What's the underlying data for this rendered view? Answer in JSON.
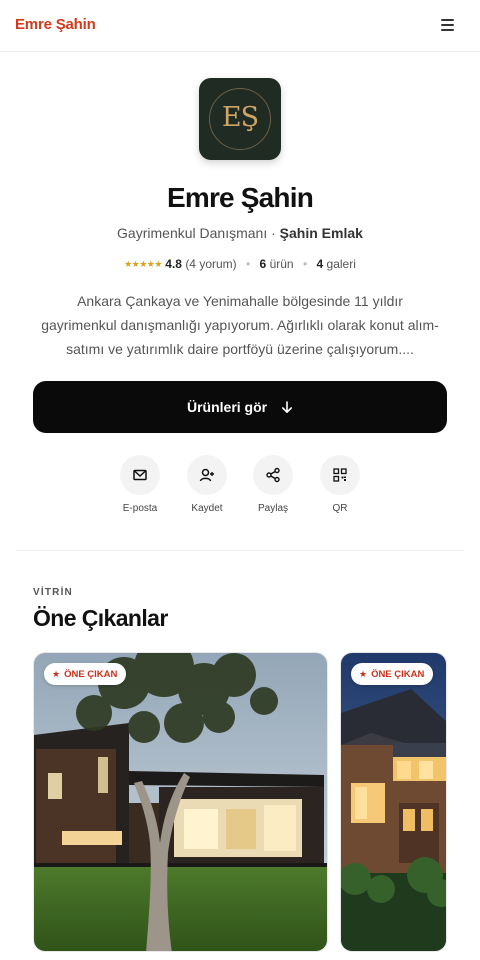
{
  "header": {
    "brand": "Emre Şahin",
    "menu_icon": "hamburger-menu-icon"
  },
  "profile": {
    "logo_text": "EŞ",
    "name": "Emre Şahin",
    "role": "Gayrimenkul Danışmanı",
    "separator": "·",
    "company": "Şahin Emlak",
    "stars": "★★★★★",
    "rating": "4.8",
    "reviews": "(4 yorum)",
    "products_count": "6",
    "products_label": "ürün",
    "galleries_count": "4",
    "galleries_label": "galeri",
    "bio": "Ankara Çankaya ve Yenimahalle bölgesinde 11 yıldır gayrimenkul danışmanlığı yapıyorum. Ağırlıklı olarak konut alım-satımı ve yatırımlık daire portföyü üzerine çalışıyorum...."
  },
  "cta": {
    "label": "Ürünleri gör",
    "icon": "arrow-down-icon"
  },
  "actions": [
    {
      "label": "E-posta",
      "icon": "mail-icon"
    },
    {
      "label": "Kaydet",
      "icon": "user-plus-icon"
    },
    {
      "label": "Paylaş",
      "icon": "share-icon"
    },
    {
      "label": "QR",
      "icon": "qr-code-icon"
    }
  ],
  "featured": {
    "eyebrow": "VİTRİN",
    "title": "Öne Çıkanlar",
    "cards": [
      {
        "badge": "ÖNE ÇIKAN",
        "image": "modern-house-photo"
      },
      {
        "badge": "ÖNE ÇIKAN",
        "image": "craftsman-house-photo"
      }
    ]
  },
  "colors": {
    "brand": "#d23a1b",
    "cta_bg": "#0a0a0a",
    "logo_bg": "#1f2b23",
    "logo_gold": "#cfa567",
    "star": "#d6a11c"
  }
}
